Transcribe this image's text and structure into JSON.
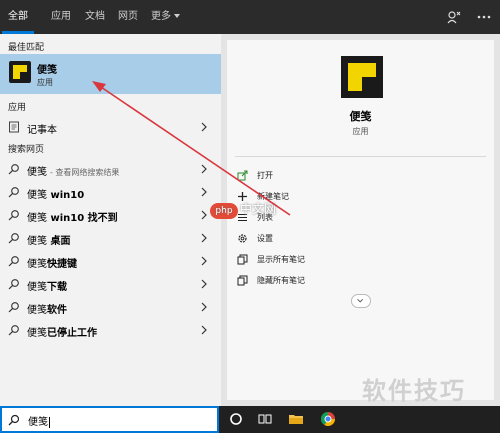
{
  "header": {
    "tabs": [
      {
        "label": "全部",
        "active": true
      },
      {
        "label": "应用"
      },
      {
        "label": "文档"
      },
      {
        "label": "网页"
      },
      {
        "label": "更多"
      }
    ]
  },
  "sections": {
    "best": "最佳匹配",
    "apps": "应用",
    "web": "搜索网页"
  },
  "best_match": {
    "title": "便笺",
    "subtitle": "应用"
  },
  "apps": [
    {
      "label": "记事本"
    }
  ],
  "web_results": [
    {
      "prefix": "便笺",
      "suffix": "",
      "muted": "- 查看网络搜索结果"
    },
    {
      "prefix": "便笺",
      "suffix": " win10",
      "muted": ""
    },
    {
      "prefix": "便笺",
      "suffix": " win10 找不到",
      "muted": ""
    },
    {
      "prefix": "便笺",
      "suffix": " 桌面",
      "muted": ""
    },
    {
      "prefix": "便笺",
      "suffix": "快捷键",
      "muted": ""
    },
    {
      "prefix": "便笺",
      "suffix": "下载",
      "muted": ""
    },
    {
      "prefix": "便笺",
      "suffix": "软件",
      "muted": ""
    },
    {
      "prefix": "便笺",
      "suffix": "已停止工作",
      "muted": ""
    }
  ],
  "detail": {
    "title": "便笺",
    "subtitle": "应用",
    "actions": [
      {
        "label": "打开"
      },
      {
        "label": "新建笔记"
      },
      {
        "label": "列表"
      },
      {
        "label": "设置"
      },
      {
        "label": "显示所有笔记"
      },
      {
        "label": "隐藏所有笔记"
      }
    ]
  },
  "search": {
    "value": "便笺"
  },
  "watermark": {
    "badge": "php",
    "text": "中文网"
  },
  "brand": "软件技巧",
  "colors": {
    "accent": "#0078d7",
    "selection": "#a8cde9",
    "arrow": "#d9363e",
    "sticky_yellow": "#f2d400"
  }
}
